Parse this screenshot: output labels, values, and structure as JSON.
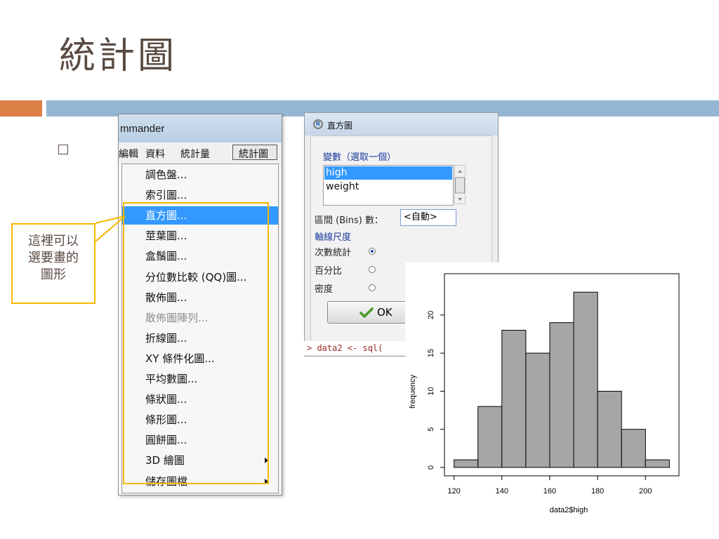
{
  "slide": {
    "title": "統計圖",
    "bullet": "□",
    "colors": {
      "accent_orange": "#dd8047",
      "accent_blue": "#94b6d2",
      "text": "#5a4a42",
      "highlight_frame": "#f5b800"
    }
  },
  "callout": {
    "lines": [
      "這裡可以",
      "選要畫的",
      "圖形"
    ]
  },
  "rcmdr_window": {
    "title_fragment": "mmander",
    "menubar": [
      "編輯",
      "資料",
      "統計量",
      "統計圖"
    ],
    "active_menu": "統計圖",
    "menu_items": [
      {
        "label": "調色盤..."
      },
      {
        "label": "索引圖..."
      },
      {
        "label": "直方圖...",
        "highlighted": true
      },
      {
        "label": "莖葉圖..."
      },
      {
        "label": "盒鬚圖..."
      },
      {
        "label": "分位數比較 (QQ)圖..."
      },
      {
        "label": "散佈圖..."
      },
      {
        "label": "散佈圖陣列...",
        "disabled": true
      },
      {
        "label": "折線圖..."
      },
      {
        "label": "XY 條件化圖..."
      },
      {
        "label": "平均數圖..."
      },
      {
        "label": "條狀圖..."
      },
      {
        "label": "條形圖..."
      },
      {
        "label": "圓餅圖..."
      },
      {
        "label": "3D 繪圖",
        "submenu": true
      },
      {
        "label": "儲存圖檔",
        "submenu": true
      }
    ]
  },
  "dialog": {
    "title": "直方圖",
    "variable_label": "變數（選取一個）",
    "variables": [
      "high",
      "weight"
    ],
    "selected_variable": "high",
    "bins_label": "區間 (Bins) 數：",
    "bins_value": "<自動>",
    "axis_scale_label": "軸線尺度",
    "scale_options": [
      {
        "label": "次數統計",
        "selected": true
      },
      {
        "label": "百分比",
        "selected": false
      },
      {
        "label": "密度",
        "selected": false
      }
    ],
    "ok_label": "OK",
    "console_line": "> data2 <- sql("
  },
  "chart_data": {
    "type": "bar",
    "title": "",
    "xlabel": "data2$high",
    "ylabel": "frequency",
    "bins": [
      {
        "from": 120,
        "to": 130,
        "count": 1
      },
      {
        "from": 130,
        "to": 140,
        "count": 8
      },
      {
        "from": 140,
        "to": 150,
        "count": 18
      },
      {
        "from": 150,
        "to": 160,
        "count": 15
      },
      {
        "from": 160,
        "to": 170,
        "count": 19
      },
      {
        "from": 170,
        "to": 180,
        "count": 23
      },
      {
        "from": 180,
        "to": 190,
        "count": 10
      },
      {
        "from": 190,
        "to": 200,
        "count": 5
      },
      {
        "from": 200,
        "to": 210,
        "count": 1
      }
    ],
    "xlim": [
      120,
      210
    ],
    "ylim": [
      0,
      23
    ],
    "x_ticks": [
      120,
      140,
      160,
      180,
      200
    ],
    "y_ticks": [
      0,
      5,
      10,
      15,
      20
    ],
    "bar_color": "#a6a6a6",
    "grid": false
  }
}
